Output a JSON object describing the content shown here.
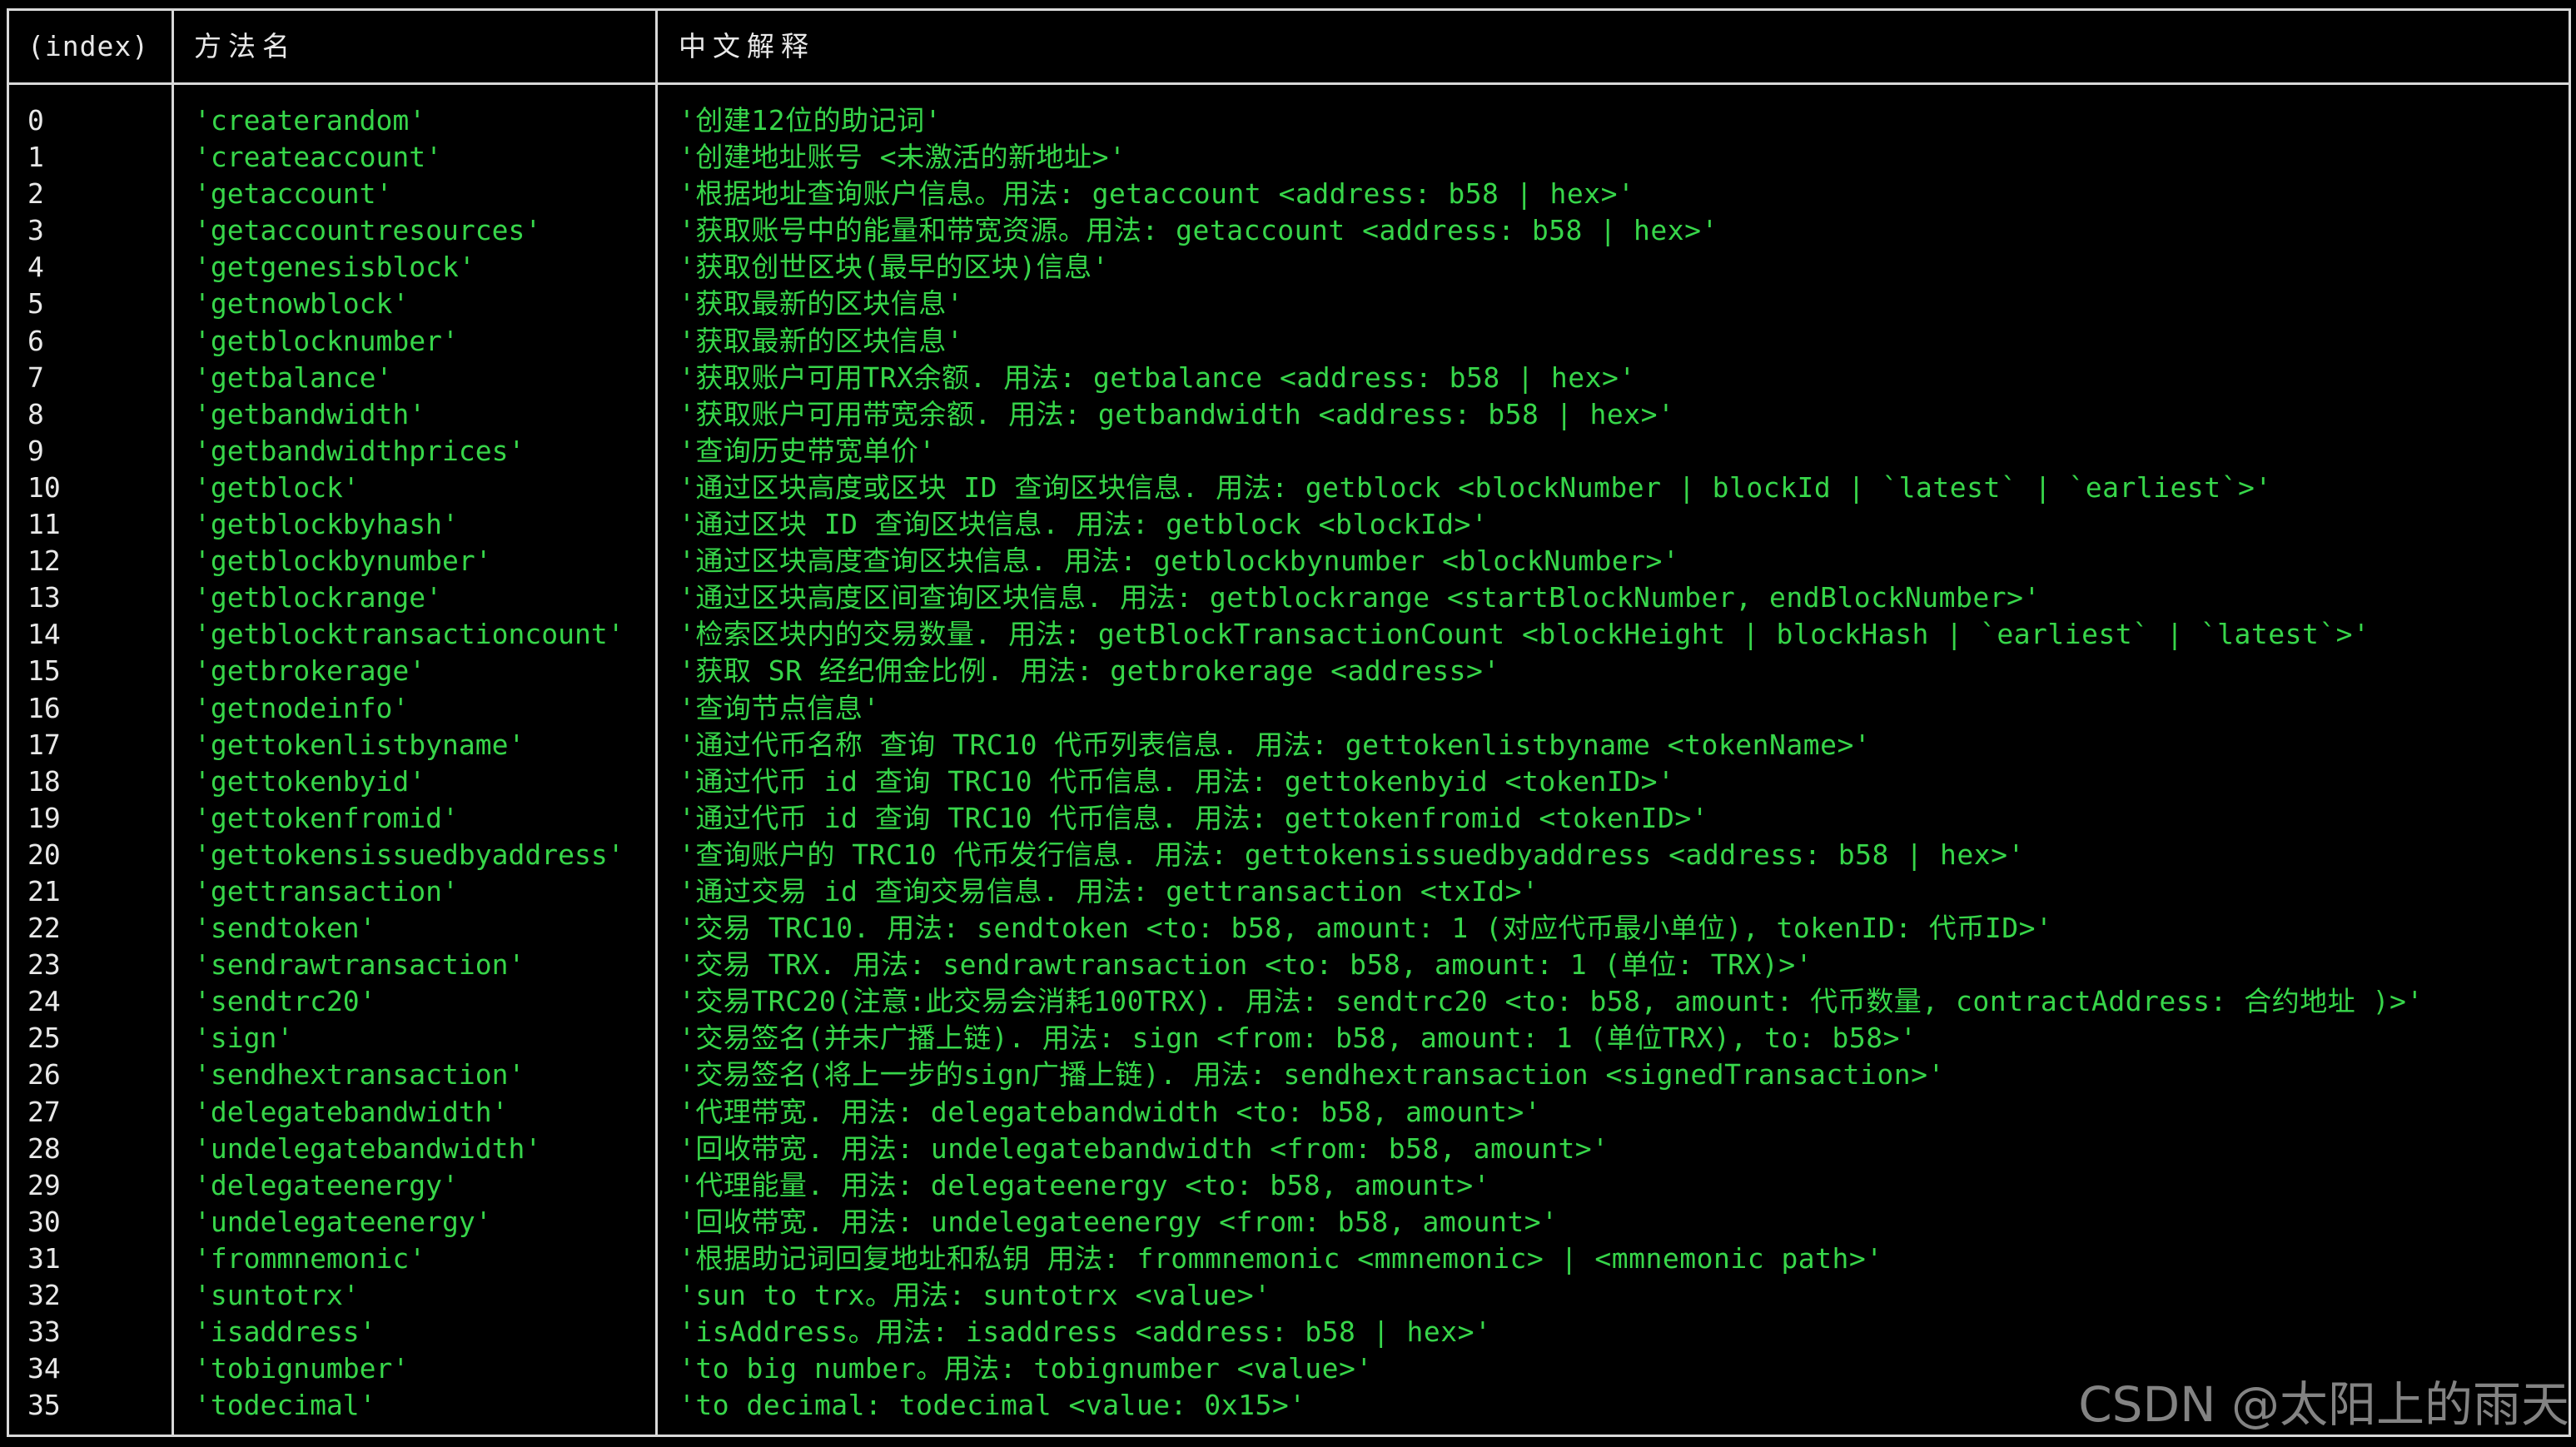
{
  "header": {
    "index_label": "(index)",
    "method_label": "方法名",
    "desc_label": "中文解释"
  },
  "rows": [
    {
      "index": "0",
      "method": "'createrandom'",
      "desc": "'创建12位的助记词'"
    },
    {
      "index": "1",
      "method": "'createaccount'",
      "desc": "'创建地址账号 <未激活的新地址>'"
    },
    {
      "index": "2",
      "method": "'getaccount'",
      "desc": "'根据地址查询账户信息。用法: getaccount <address: b58 | hex>'"
    },
    {
      "index": "3",
      "method": "'getaccountresources'",
      "desc": "'获取账号中的能量和带宽资源。用法: getaccount <address: b58 | hex>'"
    },
    {
      "index": "4",
      "method": "'getgenesisblock'",
      "desc": "'获取创世区块(最早的区块)信息'"
    },
    {
      "index": "5",
      "method": "'getnowblock'",
      "desc": "'获取最新的区块信息'"
    },
    {
      "index": "6",
      "method": "'getblocknumber'",
      "desc": "'获取最新的区块信息'"
    },
    {
      "index": "7",
      "method": "'getbalance'",
      "desc": "'获取账户可用TRX余额. 用法: getbalance <address: b58 | hex>'"
    },
    {
      "index": "8",
      "method": "'getbandwidth'",
      "desc": "'获取账户可用带宽余额. 用法: getbandwidth <address: b58 | hex>'"
    },
    {
      "index": "9",
      "method": "'getbandwidthprices'",
      "desc": "'查询历史带宽单价'"
    },
    {
      "index": "10",
      "method": "'getblock'",
      "desc": "'通过区块高度或区块 ID 查询区块信息. 用法: getblock <blockNumber | blockId | `latest` | `earliest`>'"
    },
    {
      "index": "11",
      "method": "'getblockbyhash'",
      "desc": "'通过区块 ID 查询区块信息. 用法: getblock <blockId>'"
    },
    {
      "index": "12",
      "method": "'getblockbynumber'",
      "desc": "'通过区块高度查询区块信息. 用法: getblockbynumber <blockNumber>'"
    },
    {
      "index": "13",
      "method": "'getblockrange'",
      "desc": "'通过区块高度区间查询区块信息. 用法: getblockrange <startBlockNumber, endBlockNumber>'"
    },
    {
      "index": "14",
      "method": "'getblocktransactioncount'",
      "desc": "'检索区块内的交易数量. 用法: getBlockTransactionCount <blockHeight | blockHash | `earliest` | `latest`>'"
    },
    {
      "index": "15",
      "method": "'getbrokerage'",
      "desc": "'获取 SR 经纪佣金比例. 用法: getbrokerage <address>'"
    },
    {
      "index": "16",
      "method": "'getnodeinfo'",
      "desc": "'查询节点信息'"
    },
    {
      "index": "17",
      "method": "'gettokenlistbyname'",
      "desc": "'通过代币名称 查询 TRC10 代币列表信息. 用法: gettokenlistbyname <tokenName>'"
    },
    {
      "index": "18",
      "method": "'gettokenbyid'",
      "desc": "'通过代币 id 查询 TRC10 代币信息. 用法: gettokenbyid <tokenID>'"
    },
    {
      "index": "19",
      "method": "'gettokenfromid'",
      "desc": "'通过代币 id 查询 TRC10 代币信息. 用法: gettokenfromid <tokenID>'"
    },
    {
      "index": "20",
      "method": "'gettokensissuedbyaddress'",
      "desc": "'查询账户的 TRC10 代币发行信息. 用法: gettokensissuedbyaddress <address: b58 | hex>'"
    },
    {
      "index": "21",
      "method": "'gettransaction'",
      "desc": "'通过交易 id 查询交易信息. 用法: gettransaction <txId>'"
    },
    {
      "index": "22",
      "method": "'sendtoken'",
      "desc": "'交易 TRC10. 用法: sendtoken <to: b58, amount: 1 (对应代币最小单位), tokenID: 代币ID>'"
    },
    {
      "index": "23",
      "method": "'sendrawtransaction'",
      "desc": "'交易 TRX. 用法: sendrawtransaction <to: b58, amount: 1 (单位: TRX)>'"
    },
    {
      "index": "24",
      "method": "'sendtrc20'",
      "desc": "'交易TRC20(注意:此交易会消耗100TRX). 用法: sendtrc20 <to: b58, amount: 代币数量, contractAddress: 合约地址 )>'"
    },
    {
      "index": "25",
      "method": "'sign'",
      "desc": "'交易签名(并未广播上链). 用法: sign <from: b58, amount: 1 (单位TRX), to: b58>'"
    },
    {
      "index": "26",
      "method": "'sendhextransaction'",
      "desc": "'交易签名(将上一步的sign广播上链). 用法: sendhextransaction <signedTransaction>'"
    },
    {
      "index": "27",
      "method": "'delegatebandwidth'",
      "desc": "'代理带宽. 用法: delegatebandwidth <to: b58, amount>'"
    },
    {
      "index": "28",
      "method": "'undelegatebandwidth'",
      "desc": "'回收带宽. 用法: undelegatebandwidth <from: b58, amount>'"
    },
    {
      "index": "29",
      "method": "'delegateenergy'",
      "desc": "'代理能量. 用法: delegateenergy <to: b58, amount>'"
    },
    {
      "index": "30",
      "method": "'undelegateenergy'",
      "desc": "'回收带宽. 用法: undelegateenergy <from: b58, amount>'"
    },
    {
      "index": "31",
      "method": "'frommnemonic'",
      "desc": "'根据助记词回复地址和私钥 用法: frommnemonic <mmnemonic> | <mmnemonic path>'"
    },
    {
      "index": "32",
      "method": "'suntotrx'",
      "desc": "'sun to trx。用法: suntotrx <value>'"
    },
    {
      "index": "33",
      "method": "'isaddress'",
      "desc": "'isAddress。用法: isaddress <address: b58 | hex>'"
    },
    {
      "index": "34",
      "method": "'tobignumber'",
      "desc": "'to big number。用法: tobignumber <value>'"
    },
    {
      "index": "35",
      "method": "'todecimal'",
      "desc": "'to decimal: todecimal <value: 0x15>'"
    }
  ],
  "watermark": "CSDN @太阳上的雨天",
  "colors": {
    "background": "#000000",
    "border": "#d9d9d9",
    "header_text": "#e8e8e8",
    "index_text": "#e8e8e8",
    "string_text": "#37d64a",
    "watermark": "#9a9a9a"
  }
}
